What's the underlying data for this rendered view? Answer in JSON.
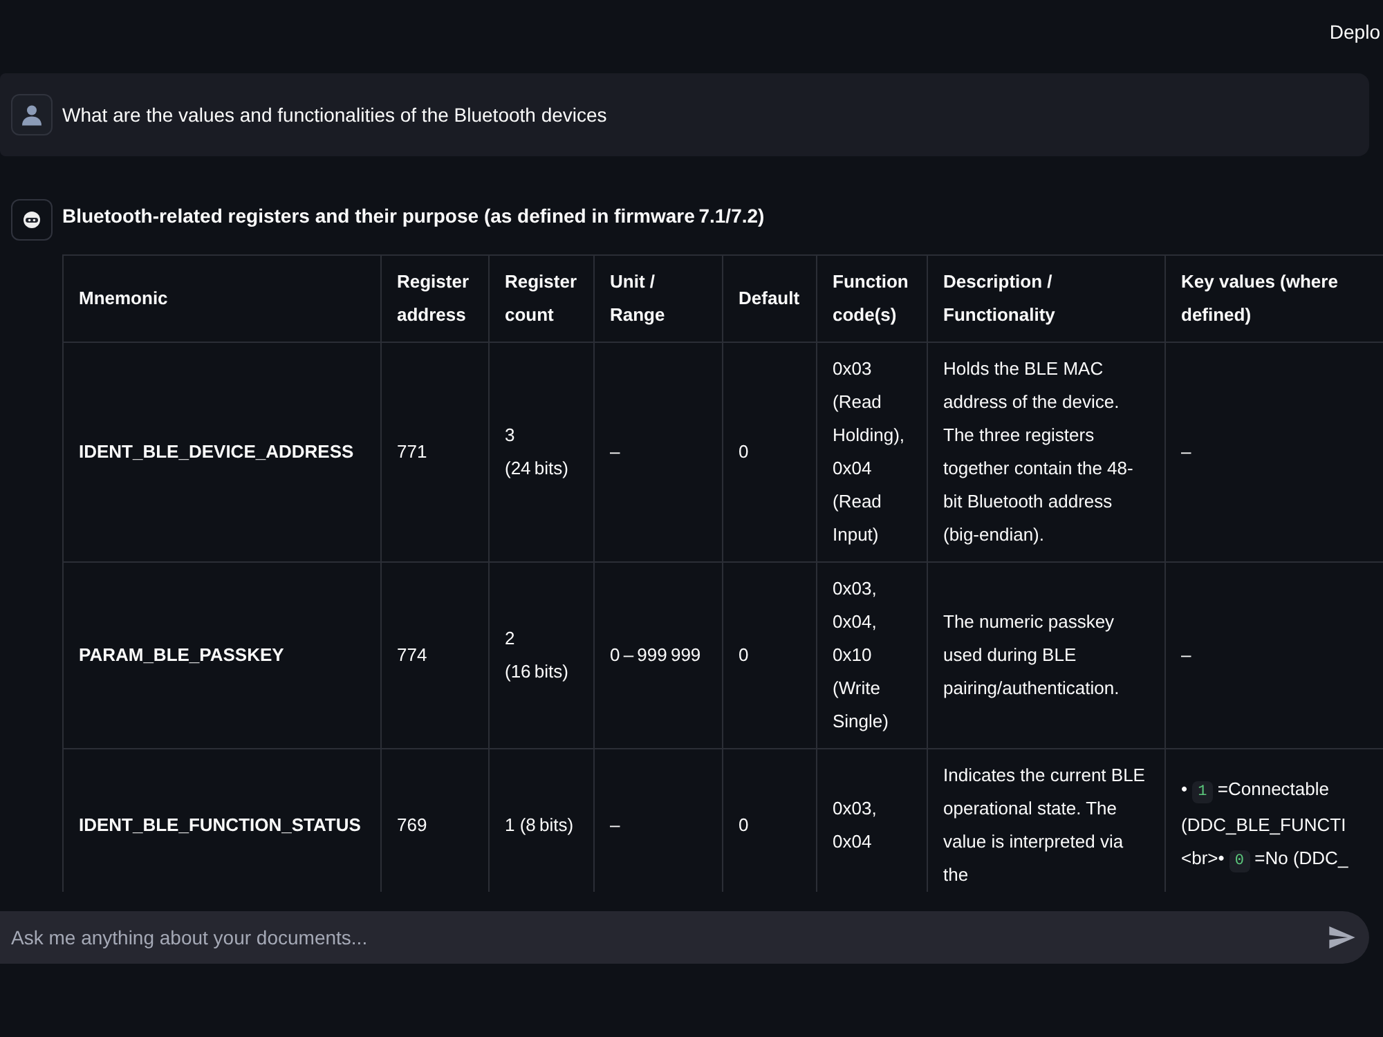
{
  "header": {
    "deploy_button": "Deplo"
  },
  "messages": [
    {
      "kind": "user",
      "text": "What are the values and functionalities of the Bluetooth devices"
    },
    {
      "kind": "assistant",
      "heading": "Bluetooth-related registers and their purpose (as defined in firmware 7.1/7.2)",
      "table": {
        "columns": [
          "Mnemonic",
          "Register address",
          "Register count",
          "Unit / Range",
          "Default",
          "Function code(s)",
          "Description / Functionality",
          "Key values (where defined)"
        ],
        "rows": [
          {
            "mnemonic": "IDENT_BLE_DEVICE_ADDRESS",
            "register_address": "771",
            "register_count": "3 (24 bits)",
            "unit_range": "–",
            "default": "0",
            "function_codes": "0x03 (Read Holding), 0x04 (Read Input)",
            "description": "Holds the BLE MAC address of the device. The three registers together contain the 48-bit Bluetooth address (big-endian).",
            "key_values": [
              [
                {
                  "kind": "text",
                  "text": "–"
                }
              ]
            ]
          },
          {
            "mnemonic": "PARAM_BLE_PASSKEY",
            "register_address": "774",
            "register_count": "2 (16 bits)",
            "unit_range": "0 – 999 999",
            "default": "0",
            "function_codes": "0x03, 0x04, 0x10 (Write Single)",
            "description": "The numeric passkey used during BLE pairing/authentication.",
            "key_values": [
              [
                {
                  "kind": "text",
                  "text": "–"
                }
              ]
            ]
          },
          {
            "mnemonic": "IDENT_BLE_FUNCTION_STATUS",
            "register_address": "769",
            "register_count": "1 (8 bits)",
            "unit_range": "–",
            "default": "0",
            "function_codes": "0x03, 0x04",
            "description": "Indicates the current BLE operational state. The value is interpreted via the",
            "key_values": [
              [
                {
                  "kind": "text",
                  "text": "• "
                },
                {
                  "kind": "code",
                  "text": "1"
                },
                {
                  "kind": "text",
                  "text": " =Connectable"
                }
              ],
              [
                {
                  "kind": "text",
                  "text": "(DDC_BLE_FUNCTI"
                }
              ],
              [
                {
                  "kind": "text",
                  "text": "<br>• "
                },
                {
                  "kind": "code",
                  "text": "0"
                },
                {
                  "kind": "text",
                  "text": " =No (DDC_"
                }
              ]
            ]
          }
        ]
      }
    }
  ],
  "chat_input": {
    "placeholder": "Ask me anything about your documents..."
  }
}
